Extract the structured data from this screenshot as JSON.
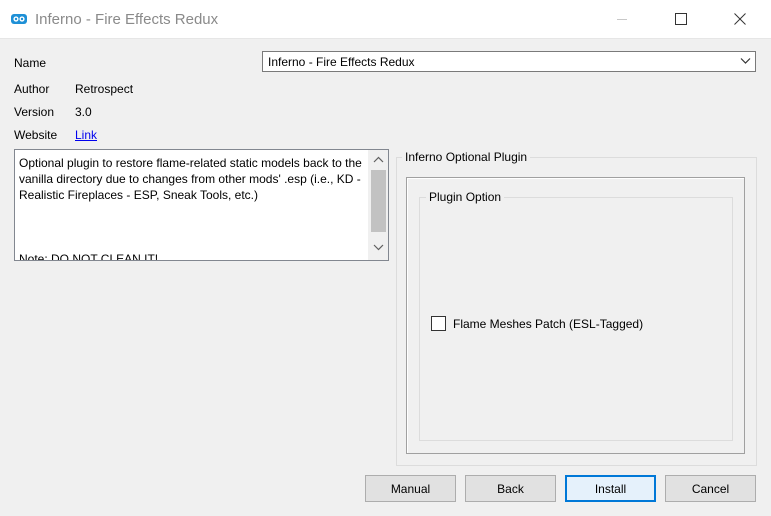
{
  "window": {
    "title": "Inferno - Fire Effects Redux",
    "icon": "mod-organizer-icon"
  },
  "fields": {
    "name_label": "Name",
    "author_label": "Author",
    "author_value": "Retrospect",
    "version_label": "Version",
    "version_value": "3.0",
    "website_label": "Website",
    "website_link": "Link"
  },
  "name_select": {
    "selected": "Inferno - Fire Effects Redux"
  },
  "description": {
    "text": "Optional plugin to restore flame-related static models back to the vanilla directory due to changes from other mods' .esp (i.e., KD - Realistic Fireplaces - ESP, Sneak Tools, etc.)",
    "note": "Note: DO NOT CLEAN IT!"
  },
  "optional_plugin_group": {
    "title": "Inferno Optional Plugin",
    "plugin_option_group": {
      "title": "Plugin Option",
      "options": [
        {
          "label": "Flame Meshes Patch (ESL-Tagged)",
          "checked": false
        }
      ]
    }
  },
  "buttons": {
    "manual": "Manual",
    "back": "Back",
    "install": "Install",
    "cancel": "Cancel"
  },
  "colors": {
    "accent": "#0078d7",
    "link": "#0000ee"
  }
}
